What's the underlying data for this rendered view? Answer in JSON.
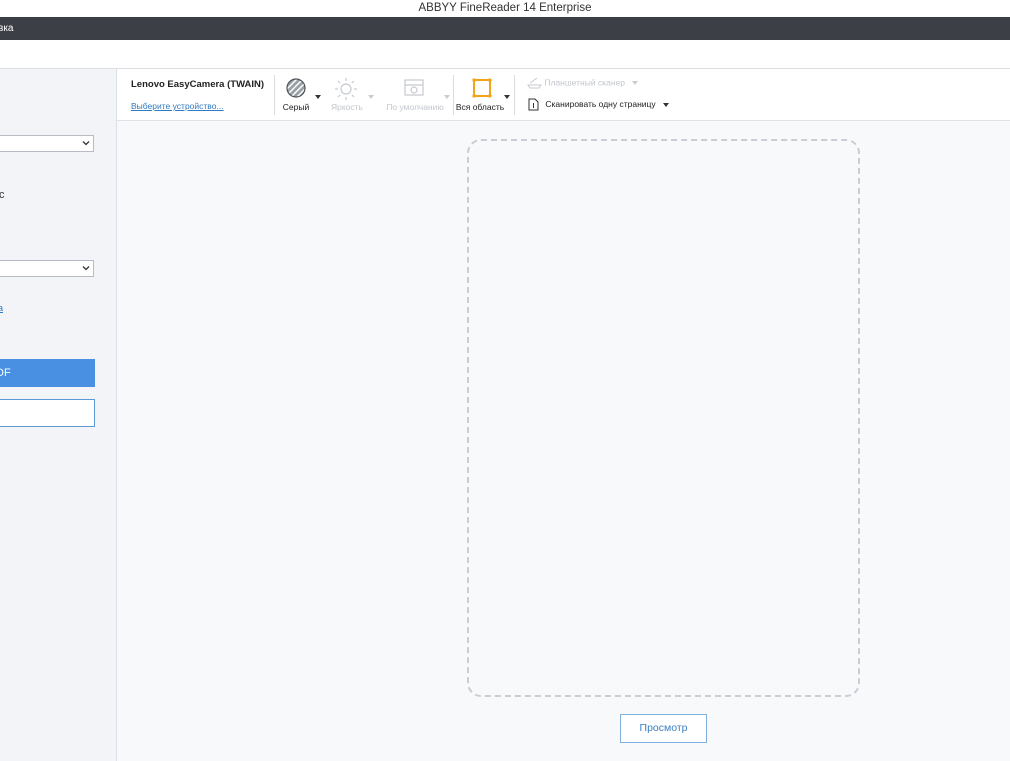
{
  "window": {
    "title": "ABBYY FineReader 14 Enterprise"
  },
  "menubar": {
    "items": [
      {
        "label": "вка"
      }
    ]
  },
  "sidebar": {
    "text_fragment": "с",
    "link_fragment": "а",
    "primary_button_label": "DF"
  },
  "toolbar": {
    "device_name": "Lenovo EasyCamera (TWAIN)",
    "select_device_link": "Выберите устройство...",
    "color_mode": {
      "label": "Серый",
      "icon": "color-mode-icon",
      "enabled": true
    },
    "brightness": {
      "label": "Яркость",
      "icon": "sun-icon",
      "enabled": false
    },
    "default": {
      "label": "По умолчанию",
      "icon": "default-settings-icon",
      "enabled": false
    },
    "area": {
      "label": "Вся область",
      "icon": "crop-area-icon",
      "enabled": true
    },
    "scanner_type": {
      "label": "Планшетный сканер",
      "icon": "flatbed-scanner-icon",
      "enabled": false
    },
    "scan_mode": {
      "label": "Сканировать одну страницу",
      "icon": "single-page-icon",
      "enabled": true
    }
  },
  "main": {
    "preview_button_label": "Просмотр"
  },
  "colors": {
    "accent": "#4a90e2",
    "highlight": "#f3a21a",
    "menubar_bg": "#3c3f46",
    "background": "#f7f9fb"
  }
}
